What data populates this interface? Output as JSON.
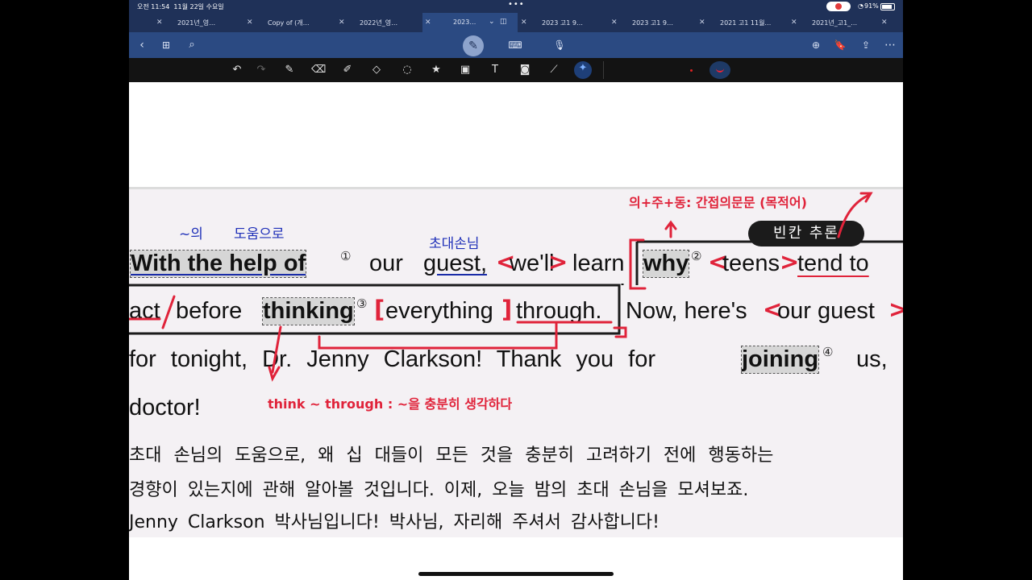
{
  "status": {
    "time": "오전 11:54",
    "date": "11월 22일 수요일",
    "battery": "91%"
  },
  "tabs": [
    {
      "label": "2021년_영…",
      "active": false
    },
    {
      "label": "Copy of (개…",
      "active": false
    },
    {
      "label": "2022년_영…",
      "active": false
    },
    {
      "label": "2023…",
      "active": true
    },
    {
      "label": "2023 고1 9…",
      "active": false
    },
    {
      "label": "2023 고1 9…",
      "active": false
    },
    {
      "label": "2021 고1 11월…",
      "active": false
    },
    {
      "label": "2021년_고1_…",
      "active": false
    }
  ],
  "toolbar": {
    "left": [
      "back-icon",
      "grid-icon",
      "search-icon"
    ],
    "center": [
      "pen-mode-icon",
      "keyboard-icon",
      "microphone-icon"
    ],
    "right": [
      "add-page-icon",
      "bookmark-icon",
      "share-icon",
      "more-icon"
    ]
  },
  "drawing_tools": [
    "undo-icon",
    "redo-icon",
    "pen-icon",
    "eraser-icon",
    "highlighter-icon",
    "shapes-icon",
    "lasso-icon",
    "sticker-icon",
    "image-icon",
    "text-icon",
    "camera-icon",
    "ruler-icon",
    "laser-icon"
  ],
  "accent": "#2b4a82",
  "ink_red": "#e0233a",
  "ink_blue": "#1e2fb8",
  "passage": {
    "line1": {
      "w1": "With the help of",
      "n1": "①",
      "w2": "our",
      "w3": "guest,",
      "w4": "we'll",
      "w5": "learn",
      "w6": "why",
      "n2": "②",
      "w7": "teens",
      "w8": "tend to"
    },
    "line2": {
      "w1": "act",
      "w2": "before",
      "w3": "thinking",
      "n3": "③",
      "w4": "everything",
      "w5": "through.",
      "w6": "Now, here's",
      "w7": "our guest"
    },
    "line3": {
      "w1": "for tonight, Dr. Jenny Clarkson! Thank you for",
      "w2": "joining",
      "n4": "④",
      "w3": "us,"
    },
    "line4": {
      "w1": "doctor!"
    }
  },
  "translation": [
    "초대 손님의 도움으로, 왜 십 대들이 모든 것을 충분히 고려하기 전에 행동하는",
    "경향이 있는지에 관해 알아볼 것입니다. 이제, 오늘 밤의 초대 손님을 모셔보죠.",
    "Jenny Clarkson 박사님입니다! 박사님, 자리해 주셔서 감사합니다!"
  ],
  "annotations": {
    "blue1": "~의",
    "blue2": "도움으로",
    "blue3": "초대손님",
    "red_top": "의+주+동: 간접의문문 (목적어)",
    "red_bottom": "think ~ through : ~을 충분히 생각하다",
    "badge": "빈칸 추론"
  }
}
